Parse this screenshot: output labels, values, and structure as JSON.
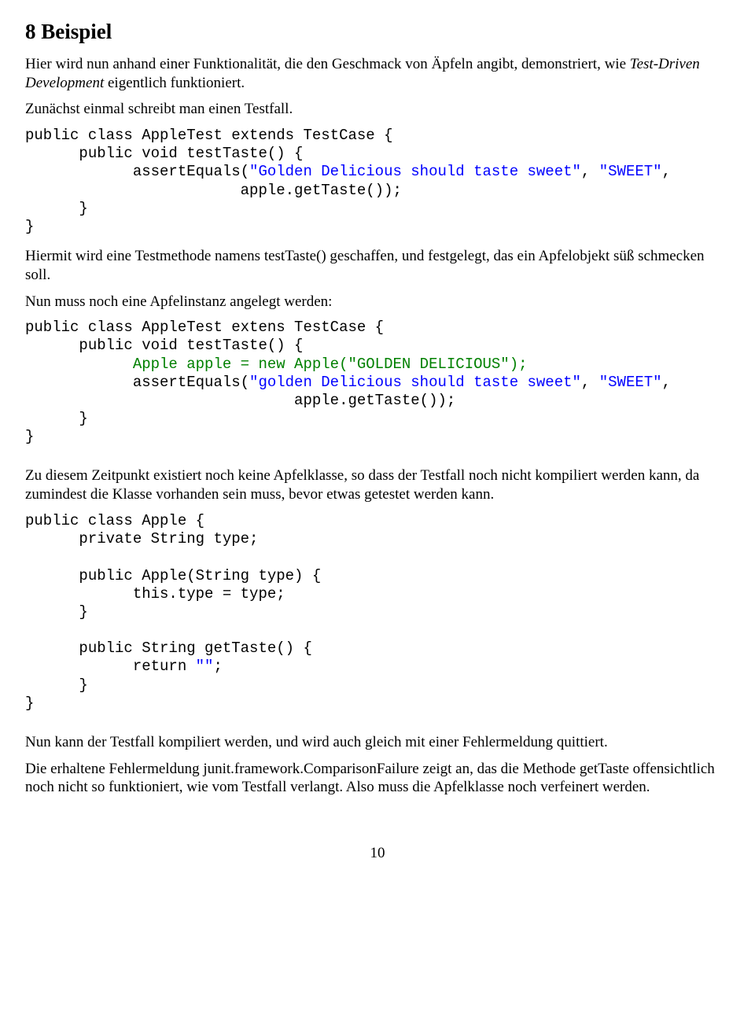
{
  "heading": "8 Beispiel",
  "p1_a": "Hier wird nun anhand einer Funktionalität, die den Geschmack von Äpfeln angibt, demonstriert, wie ",
  "p1_em": "Test-Driven Development",
  "p1_b": " eigentlich funktioniert.",
  "p2": "Zunächst einmal schreibt man einen Testfall.",
  "code1": {
    "l1": "public class AppleTest extends TestCase {",
    "l2": "      public void testTaste() {",
    "l3a": "            assertEquals(",
    "l3b": "\"Golden Delicious should taste sweet\"",
    "l3c": ", ",
    "l3d": "\"SWEET\"",
    "l3e": ",",
    "l4": "                        apple.getTaste());",
    "l5": "      }",
    "l6": "}"
  },
  "p3": "Hiermit wird eine Testmethode namens testTaste() geschaffen, und festgelegt, das ein Apfelobjekt süß schmecken soll.",
  "p4": "Nun muss noch eine Apfelinstanz angelegt werden:",
  "code2": {
    "l1": "public class AppleTest extens TestCase {",
    "l2": "      public void testTaste() {",
    "l3a": "            Apple apple = new Apple(",
    "l3b": "\"GOLDEN DELICIOUS\"",
    "l3c": ");",
    "l4a": "            assertEquals(",
    "l4b": "\"golden Delicious should taste sweet\"",
    "l4c": ", ",
    "l4d": "\"SWEET\"",
    "l4e": ",",
    "l5": "                              apple.getTaste());",
    "l6": "      }",
    "l7": "}"
  },
  "p5": "Zu diesem Zeitpunkt existiert noch keine Apfelklasse, so dass der Testfall noch nicht kompiliert werden kann, da zumindest die Klasse vorhanden sein muss, bevor etwas getestet werden kann.",
  "code3": {
    "l1": "public class Apple {",
    "l2": "      private String type;",
    "l3": "",
    "l4": "      public Apple(String type) {",
    "l5": "            this.type = type;",
    "l6": "      }",
    "l7": "",
    "l8": "      public String getTaste() {",
    "l9a": "            return ",
    "l9b": "\"\"",
    "l9c": ";",
    "l10": "      }",
    "l11": "}"
  },
  "p6": "Nun kann der Testfall kompiliert werden, und wird auch gleich mit einer Fehlermeldung quittiert.",
  "p7": "Die erhaltene Fehlermeldung junit.framework.ComparisonFailure zeigt an, das die Methode getTaste offensichtlich noch nicht so funktioniert, wie vom Testfall verlangt. Also muss die Apfelklasse noch verfeinert werden.",
  "page_number": "10"
}
